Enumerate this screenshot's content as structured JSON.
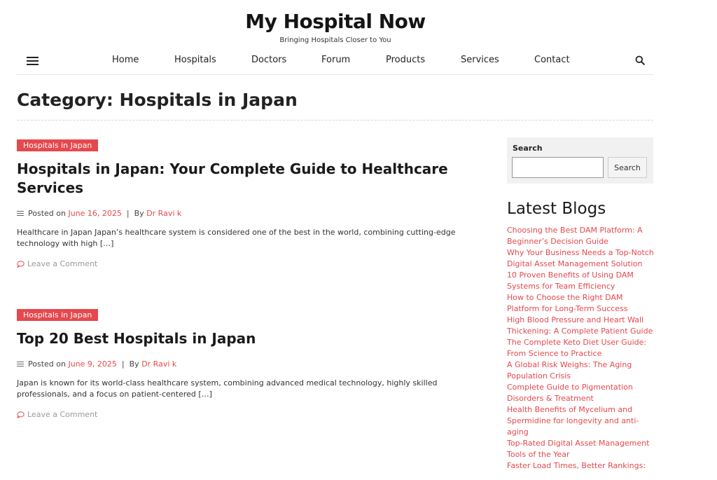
{
  "header": {
    "site_title": "My Hospital Now",
    "tagline": "Bringing Hospitals Closer to You"
  },
  "nav": {
    "items": [
      "Home",
      "Hospitals",
      "Doctors",
      "Forum",
      "Products",
      "Services",
      "Contact"
    ]
  },
  "category": {
    "title": "Category: Hospitals in Japan"
  },
  "posts": [
    {
      "badge": "Hospitals in Japan",
      "title": "Hospitals in Japan: Your Complete Guide to Healthcare Services",
      "posted_on_label": "Posted on",
      "date": "June 16, 2025",
      "separator": "|",
      "by_label": "By",
      "author": "Dr Ravi k",
      "excerpt": "Healthcare in Japan Japan’s healthcare system is considered one of the best in the world, combining cutting-edge technology with high […]",
      "comment_label": "Leave a Comment"
    },
    {
      "badge": "Hospitals in Japan",
      "title": "Top 20 Best Hospitals in Japan",
      "posted_on_label": "Posted on",
      "date": "June 9, 2025",
      "separator": "|",
      "by_label": "By",
      "author": "Dr Ravi k",
      "excerpt": "Japan is known for its world-class healthcare system, combining advanced medical technology, highly skilled professionals, and a focus on patient-centered […]",
      "comment_label": "Leave a Comment"
    }
  ],
  "sidebar": {
    "search_label": "Search",
    "search_value": "",
    "search_button": "Search",
    "blogs_heading": "Latest Blogs",
    "blogs": [
      "Choosing the Best DAM Platform: A Beginner’s Decision Guide",
      "Why Your Business Needs a Top-Notch Digital Asset Management Solution",
      "10 Proven Benefits of Using DAM Systems for Team Efficiency",
      "How to Choose the Right DAM Platform for Long-Term Success",
      "High Blood Pressure and Heart Wall Thickening: A Complete Patient Guide",
      "The Complete Keto Diet User Guide: From Science to Practice",
      "A Global Risk Weighs: The Aging Population Crisis",
      "Complete Guide to Pigmentation Disorders & Treatment",
      "Health Benefits of Mycelium and Spermidine for longevity and anti-aging",
      "Top-Rated Digital Asset Management Tools of the Year",
      "Faster Load Times, Better Rankings:"
    ]
  },
  "colors": {
    "accent": "#e5484d",
    "text": "#222222",
    "widget_bg": "#f1f1f1"
  },
  "icons": {
    "menu": "hamburger-icon",
    "search": "search-icon",
    "meta": "list-icon",
    "comment": "comment-icon"
  }
}
